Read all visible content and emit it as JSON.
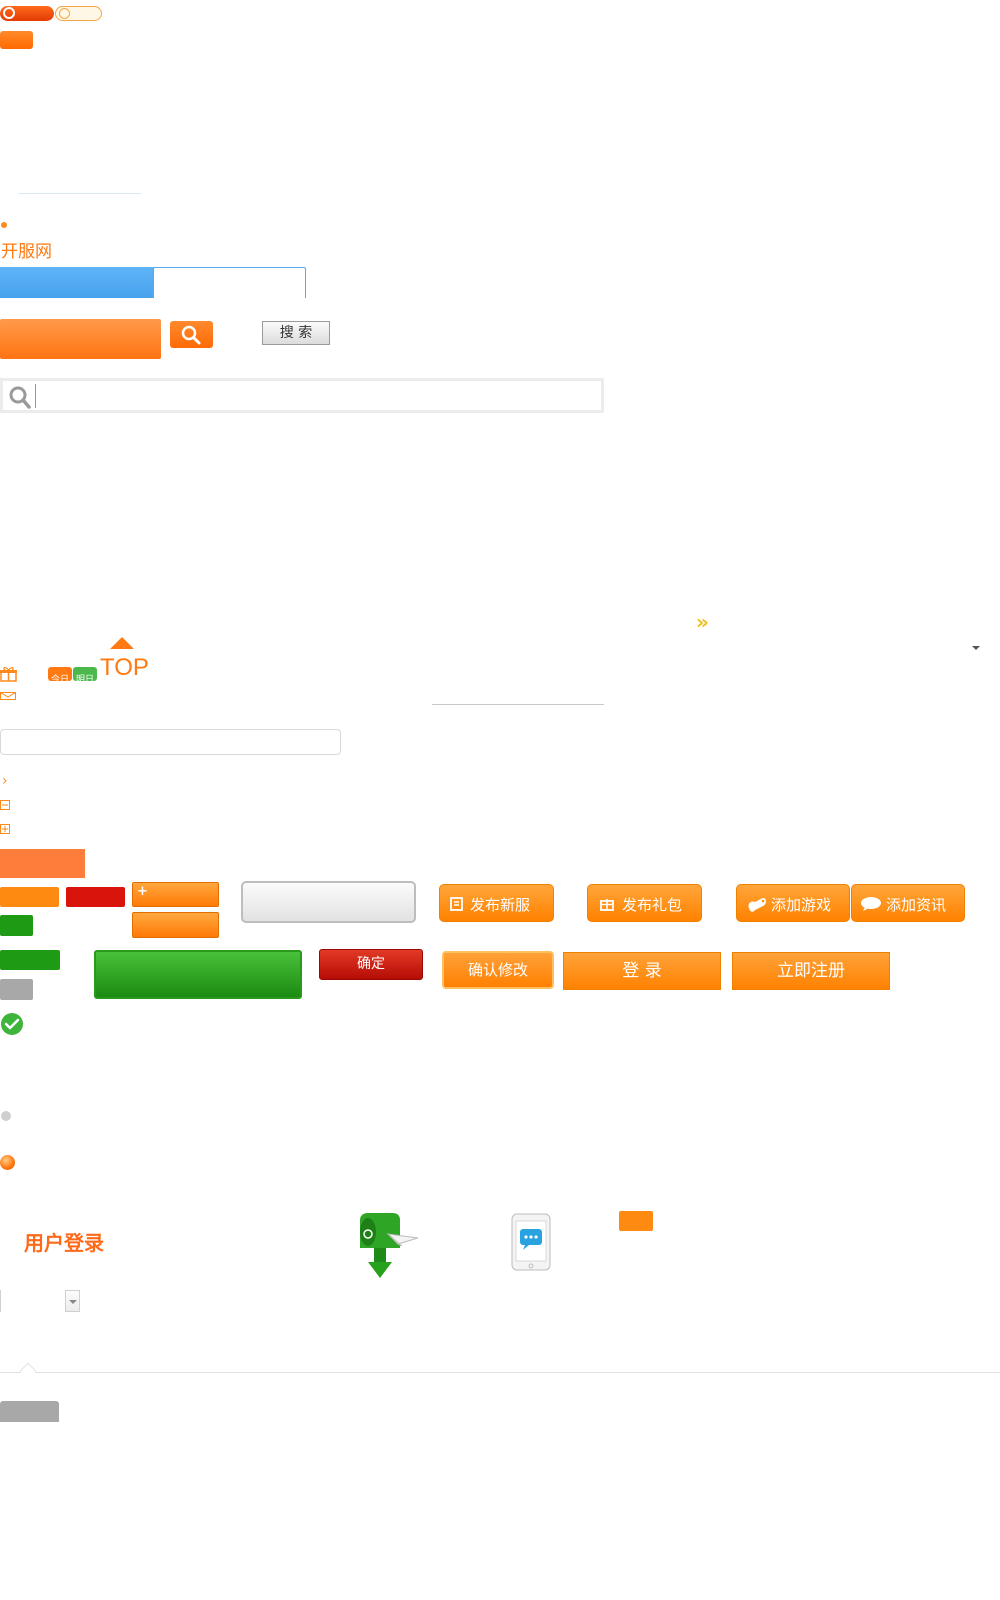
{
  "colors": {
    "orange": "#ff8a1c",
    "red": "#d9140d",
    "green": "#1e9a14",
    "blue": "#54aaf0",
    "gray": "#a8a8a8"
  },
  "brand": {
    "site_name": "开服网"
  },
  "search": {
    "button_label": "搜 索"
  },
  "badges": {
    "today": "今日",
    "tomorrow": "明日"
  },
  "back_to_top": {
    "label": "TOP"
  },
  "buttons": {
    "publish_server": "发布新服",
    "publish_gift": "发布礼包",
    "add_game": "添加游戏",
    "add_news": "添加资讯",
    "confirm": "确定",
    "confirm_edit": "确认修改",
    "login": "登 录",
    "register": "立即注册",
    "plus": "+"
  },
  "login": {
    "title": "用户登录"
  },
  "icons": [
    "clock-icon",
    "search-icon",
    "magnifier-icon",
    "double-chevron-right-icon",
    "caret-down-icon",
    "gift-icon",
    "mail-icon",
    "chevron-right-icon",
    "minus-box-icon",
    "plus-box-icon",
    "checkmark-icon",
    "gamepad-icon",
    "speech-bubble-icon",
    "mailbox-icon",
    "phone-chat-icon"
  ]
}
